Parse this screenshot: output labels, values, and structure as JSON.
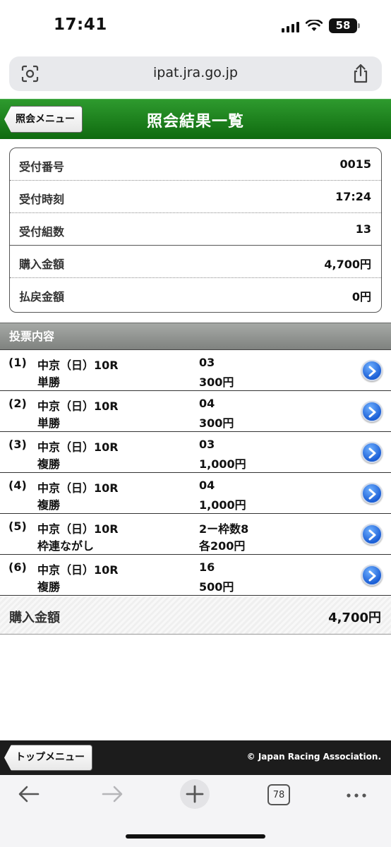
{
  "status": {
    "time": "17:41",
    "battery": "58"
  },
  "browser": {
    "url": "ipat.jra.go.jp",
    "tabs_count": "78"
  },
  "header": {
    "back_label": "照会メニュー",
    "title": "照会結果一覧"
  },
  "summary": [
    {
      "label": "受付番号",
      "value": "0015"
    },
    {
      "label": "受付時刻",
      "value": "17:24"
    },
    {
      "label": "受付組数",
      "value": "13"
    },
    {
      "label": "購入金額",
      "value": "4,700円"
    },
    {
      "label": "払戻金額",
      "value": "0円"
    }
  ],
  "section_title": "投票内容",
  "bets": [
    {
      "num": "(1)",
      "race": "中京（日）10R",
      "type": "単勝",
      "combo": "03",
      "amount": "300円"
    },
    {
      "num": "(2)",
      "race": "中京（日）10R",
      "type": "単勝",
      "combo": "04",
      "amount": "300円"
    },
    {
      "num": "(3)",
      "race": "中京（日）10R",
      "type": "複勝",
      "combo": "03",
      "amount": "1,000円"
    },
    {
      "num": "(4)",
      "race": "中京（日）10R",
      "type": "複勝",
      "combo": "04",
      "amount": "1,000円"
    },
    {
      "num": "(5)",
      "race": "中京（日）10R",
      "type": "枠連ながし",
      "combo": "2ー枠数8",
      "amount": "各200円"
    },
    {
      "num": "(6)",
      "race": "中京（日）10R",
      "type": "複勝",
      "combo": "16",
      "amount": "500円"
    }
  ],
  "total": {
    "label": "購入金額",
    "value": "4,700円"
  },
  "footer": {
    "top_menu_label": "トップメニュー",
    "copyright": "© Japan Racing Association."
  },
  "colors": {
    "header_green": "#1a7d1a",
    "arrow_blue": "#1b5fd6"
  }
}
